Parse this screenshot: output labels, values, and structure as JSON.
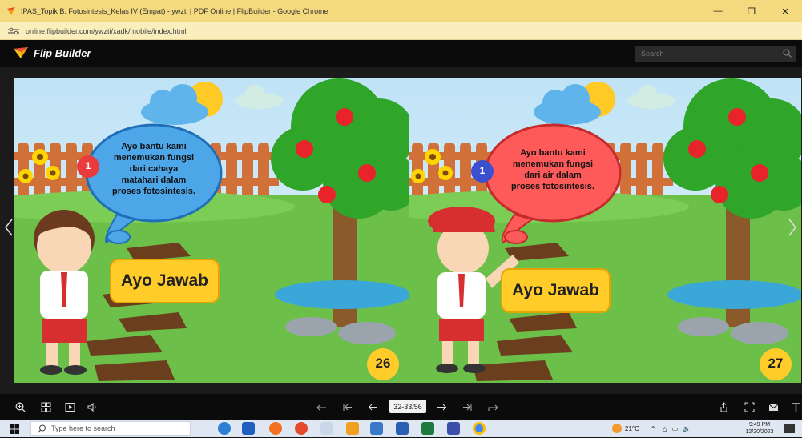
{
  "browser": {
    "window_title": "IPAS_Topik B. Fotosintesis_Kelas IV (Empat) - ywzti | PDF Online | FlipBuilder - Google Chrome",
    "url": "online.flipbuilder.com/ywzti/xadk/mobile/index.html"
  },
  "app": {
    "logo_text": "Flip Builder",
    "search_placeholder": "Search"
  },
  "pages": {
    "left": {
      "step": "1",
      "bubble_lines": [
        "Ayo bantu kami",
        "menemukan fungsi",
        "dari cahaya",
        "matahari dalam",
        "proses fotosintesis."
      ],
      "button": "Ayo Jawab",
      "page_number": "26"
    },
    "right": {
      "step": "1",
      "bubble_lines": [
        "Ayo bantu kami",
        "menemukan fungsi",
        "dari air dalam",
        "proses fotosintesis."
      ],
      "button": "Ayo Jawab",
      "page_number": "27"
    }
  },
  "toolbar": {
    "page_indicator": "32-33/56"
  },
  "taskbar": {
    "search_placeholder": "Type here to search",
    "temperature": "21°C",
    "time": "9:49 PM",
    "date": "12/20/2023"
  },
  "colors": {
    "title_bar": "#f5d97e",
    "app_header": "#0b0b0b",
    "sky": "#cfe9f7",
    "grass": "#6cc04a",
    "bubble_left": "#4da6e8",
    "bubble_right": "#ff5a5a",
    "button_yellow": "#ffcc29"
  }
}
